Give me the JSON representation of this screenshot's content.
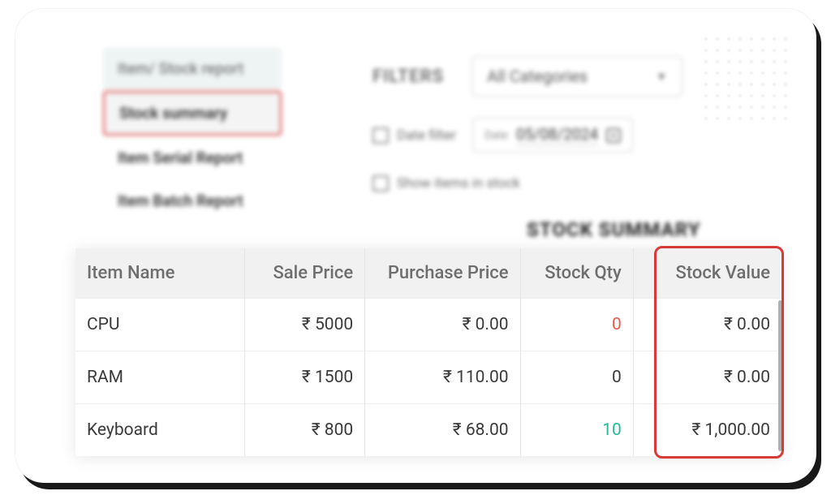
{
  "sidebar": {
    "items": [
      {
        "label": "Item/ Stock report"
      },
      {
        "label": "Stock summary"
      },
      {
        "label": "Item Serial Report"
      },
      {
        "label": "Item Batch Report"
      }
    ]
  },
  "filters": {
    "label": "FILTERS",
    "category_value": "All Categories",
    "date_filter_label": "Date filter",
    "date_prefix": "Date",
    "date_value": "05/08/2024",
    "show_in_stock_label": "Show items in stock"
  },
  "page_title": "STOCK SUMMARY",
  "table": {
    "headers": {
      "name": "Item Name",
      "sale": "Sale Price",
      "purchase": "Purchase Price",
      "qty": "Stock Qty",
      "value": "Stock Value"
    },
    "rows": [
      {
        "name": "CPU",
        "sale": "₹ 5000",
        "purchase": "₹ 0.00",
        "qty": "0",
        "qty_style": "zero",
        "value": "₹ 0.00"
      },
      {
        "name": "RAM",
        "sale": "₹ 1500",
        "purchase": "₹ 110.00",
        "qty": "0",
        "qty_style": "plain",
        "value": "₹ 0.00"
      },
      {
        "name": "Keyboard",
        "sale": "₹ 800",
        "purchase": "₹ 68.00",
        "qty": "10",
        "qty_style": "pos",
        "value": "₹ 1,000.00"
      }
    ]
  }
}
